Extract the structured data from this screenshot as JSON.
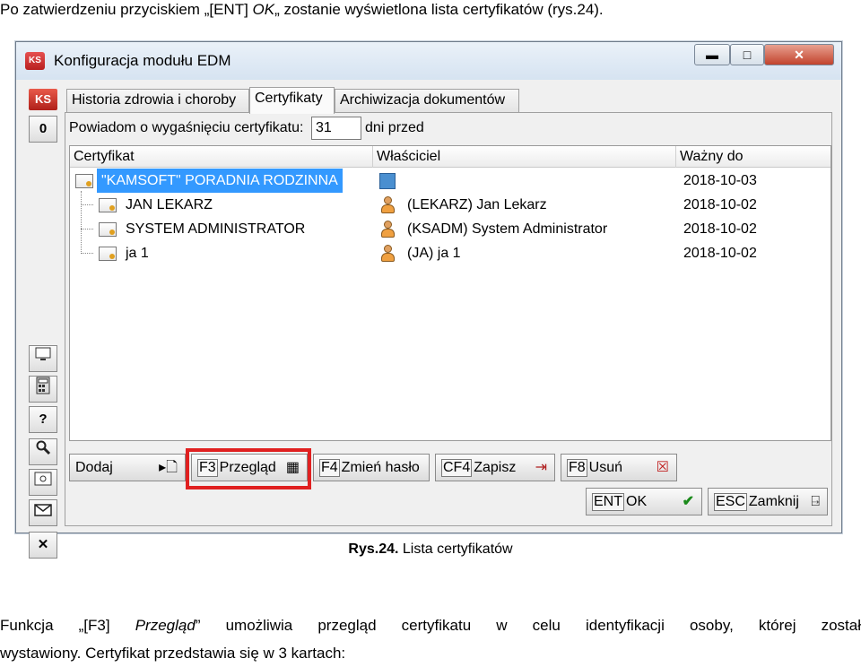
{
  "doc": {
    "intro_prefix": "Po zatwierdzeniu przyciskiem „[ENT] ",
    "intro_ok": "OK",
    "intro_suffix": "„ zostanie wyświetlona lista certyfikatów (rys.24).",
    "caption_bold": "Rys.24.",
    "caption_text": " Lista certyfikatów",
    "para_prefix": "Funkcja „[F3] ",
    "para_italic": "Przegląd",
    "para_rest": "” umożliwia przegląd certyfikatu w celu identyfikacji osoby, której został",
    "para_line2": "wystawiony. Certyfikat przedstawia się w 3 kartach:"
  },
  "window": {
    "title": "Konfiguracja modułu EDM",
    "logo_text": "KS",
    "minimize": "▬",
    "maximize": "□",
    "close": "✕"
  },
  "lefttool": {
    "logo": "KS",
    "zero": "0",
    "help": "?",
    "close": "✕"
  },
  "tabs": [
    {
      "label": "Historia zdrowia i choroby"
    },
    {
      "label": "Certyfikaty"
    },
    {
      "label": "Archiwizacja dokumentów"
    }
  ],
  "remind": {
    "label": "Powiadom o wygaśnięciu certyfikatu:",
    "value": "31",
    "after": "dni przed"
  },
  "grid": {
    "columns": [
      "Certyfikat",
      "Właściciel",
      "Ważny do"
    ],
    "rows": [
      {
        "cert": "\"KAMSOFT\" PORADNIA RODZINNA",
        "owner": "",
        "valid": "2018-10-03"
      },
      {
        "cert": "JAN LEKARZ",
        "owner": "(LEKARZ) Jan Lekarz",
        "valid": "2018-10-02"
      },
      {
        "cert": "SYSTEM ADMINISTRATOR",
        "owner": "(KSADM) System Administrator",
        "valid": "2018-10-02"
      },
      {
        "cert": "ja 1",
        "owner": "(JA) ja 1",
        "valid": "2018-10-02"
      }
    ]
  },
  "buttons": {
    "add": "Dodaj",
    "view_key": "F3",
    "view": "Przegląd",
    "pass_key": "F4",
    "pass": "Zmień hasło",
    "save_key": "CF4",
    "save": "Zapisz",
    "del_key": "F8",
    "del": "Usuń",
    "ok_key": "ENT",
    "ok": "OK",
    "close_key": "ESC",
    "close": "Zamknij"
  }
}
